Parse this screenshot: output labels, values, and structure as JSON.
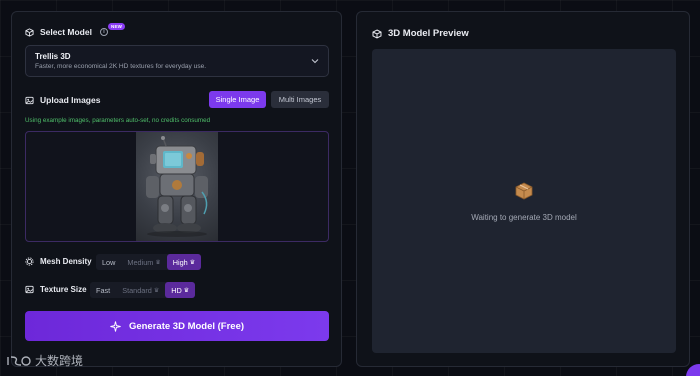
{
  "left": {
    "select_model": {
      "label": "Select Model",
      "badge": "NEW",
      "model_name": "Trellis 3D",
      "model_description": "Faster, more economical 2K HD textures for everyday use."
    },
    "upload": {
      "label": "Upload Images",
      "single_label": "Single Image",
      "multi_label": "Multi Images",
      "note": "Using example images, parameters auto-set, no credits consumed"
    },
    "mesh_density": {
      "label": "Mesh Density",
      "options": [
        "Low",
        "Medium",
        "High"
      ],
      "selected": "High"
    },
    "texture_size": {
      "label": "Texture Size",
      "options": [
        "Fast",
        "Standard",
        "HD"
      ],
      "selected": "HD"
    },
    "generate_label": "Generate 3D Model (Free)"
  },
  "right": {
    "title": "3D Model Preview",
    "waiting_text": "Waiting to generate 3D model"
  },
  "watermark_text": "大数跨境",
  "colors": {
    "accent": "#7c3aed",
    "badge": "#8b3cf6",
    "note_green": "#4fbf6a",
    "background": "#0b0d14"
  }
}
